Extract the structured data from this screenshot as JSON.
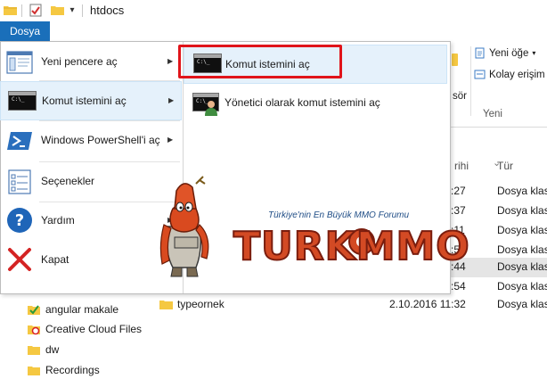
{
  "titlebar": {
    "title": "htdocs",
    "dropdown_glyph": "▾"
  },
  "ribbon": {
    "file_tab": "Dosya",
    "new_item": "Yeni öğe",
    "easy_access": "Kolay erişim",
    "group_new": "Yeni",
    "fragment_label": "sör"
  },
  "list_header": {
    "date_fragment": "rihi",
    "type": "Tür",
    "sort_glyph": "⌄"
  },
  "list_fragments": [
    {
      "time": ":27",
      "type": "Dosya klas"
    },
    {
      "time": ":37",
      "type": "Dosya klas"
    },
    {
      "time": ":11",
      "type": "Dosya klas"
    },
    {
      "time": ":52",
      "type": "Dosya klas"
    },
    {
      "time": ":44",
      "type": "Dosya klas"
    },
    {
      "time": ":54",
      "type": "Dosya klas"
    }
  ],
  "file_rows": [
    {
      "name": "typeornek",
      "date": "2.10.2016 11:32",
      "type": "Dosya klas"
    }
  ],
  "nav_items": [
    {
      "label": "angular makale",
      "icon": "green-check-icon"
    },
    {
      "label": "Creative Cloud Files",
      "icon": "creative-cloud-icon"
    },
    {
      "label": "dw",
      "icon": "folder-icon"
    },
    {
      "label": "Recordings",
      "icon": "folder-icon"
    }
  ],
  "file_menu": {
    "items": [
      {
        "label": "Yeni pencere aç",
        "icon": "new-window-icon",
        "has_submenu": true
      },
      {
        "label": "Komut istemini aç",
        "icon": "command-prompt-icon",
        "has_submenu": true,
        "active": true
      },
      {
        "label": "Windows PowerShell'i aç",
        "icon": "powershell-icon",
        "has_submenu": true
      },
      {
        "label": "Seçenekler",
        "icon": "options-icon",
        "has_submenu": false
      },
      {
        "label": "Yardım",
        "icon": "help-icon",
        "has_submenu": true
      },
      {
        "label": "Kapat",
        "icon": "close-icon",
        "has_submenu": false
      }
    ],
    "arrow_glyph": "▶",
    "submenu": [
      {
        "label": "Komut istemini aç",
        "icon": "command-prompt-icon",
        "highlighted": true
      },
      {
        "label": "Yönetici olarak komut istemini aç",
        "icon": "admin-command-prompt-icon",
        "highlighted": false
      }
    ]
  },
  "watermark": {
    "tagline": "Türkiye'nin En Büyük MMO Forumu",
    "brand": "TURKMMO"
  },
  "colors": {
    "accent": "#1a6fba",
    "menu_highlight": "#e5f1fb",
    "callout_red": "#e0141a",
    "folder_yellow": "#f5c842"
  }
}
